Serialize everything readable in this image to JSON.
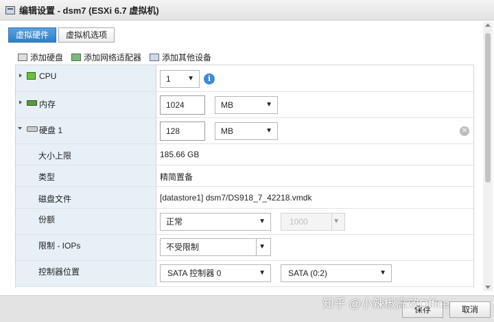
{
  "window": {
    "title": "编辑设置 - dsm7 (ESXi 6.7 虚拟机)"
  },
  "tabs": [
    {
      "label": "虚拟硬件",
      "active": true
    },
    {
      "label": "虚拟机选项",
      "active": false
    }
  ],
  "toolbar": {
    "add_disk": "添加硬盘",
    "add_network": "添加网络适配器",
    "add_other": "添加其他设备"
  },
  "rows": {
    "cpu": {
      "label": "CPU",
      "value": "1",
      "info_glyph": "i"
    },
    "memory": {
      "label": "内存",
      "value": "1024",
      "unit": "MB"
    },
    "disk": {
      "label": "硬盘 1",
      "value": "128",
      "unit": "MB",
      "remove_glyph": "✕"
    },
    "max_size": {
      "label": "大小上限",
      "value": "185.66 GB"
    },
    "type": {
      "label": "类型",
      "value": "精简置备"
    },
    "disk_file": {
      "label": "磁盘文件",
      "value": "[datastore1] dsm7/DS918_7_42218.vmdk"
    },
    "shares": {
      "label": "份额",
      "value": "正常",
      "amount": "1000"
    },
    "limit": {
      "label": "限制 - IOPs",
      "value": "不受限制"
    },
    "controller": {
      "label": "控制器位置",
      "controller": "SATA 控制器 0",
      "slot": "SATA (0:2)"
    }
  },
  "footer": {
    "save": "保存",
    "cancel": "取消"
  },
  "watermark": "知乎 @小辣椒高效Office",
  "colors": {
    "accent": "#2f7fc6",
    "label_bg": "#e7f0f7",
    "info": "#3d8ad6"
  }
}
